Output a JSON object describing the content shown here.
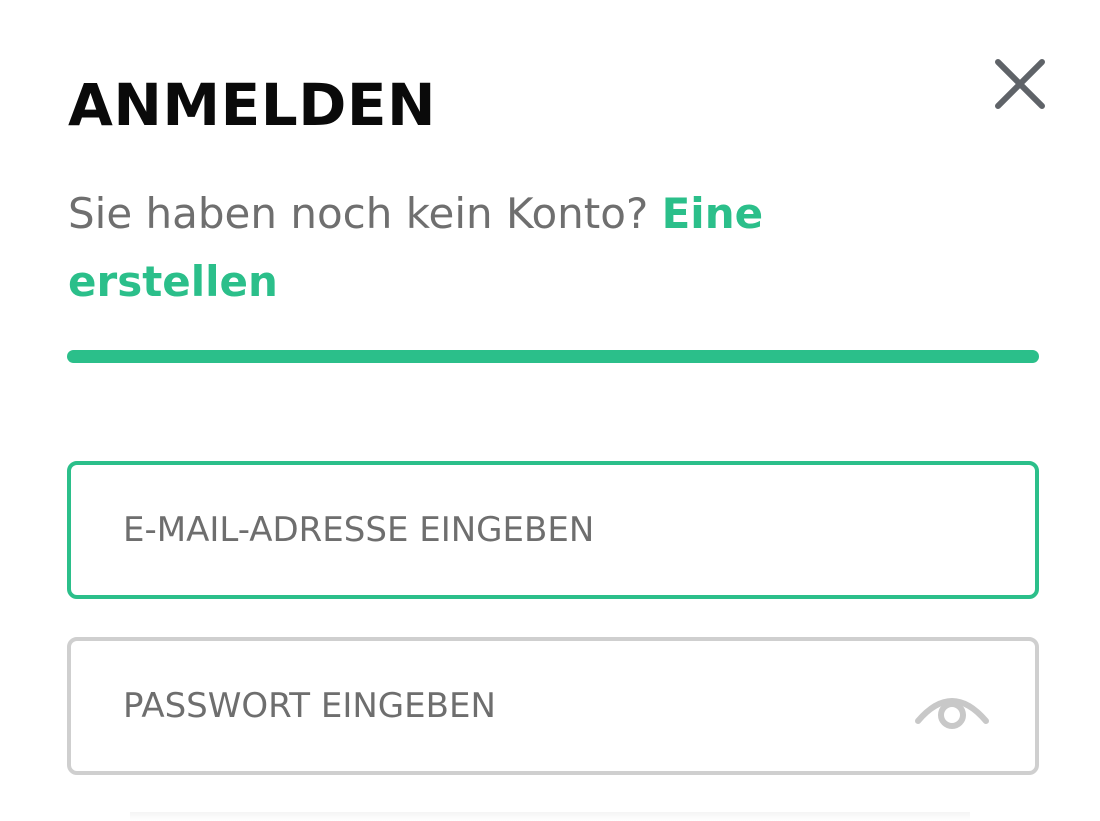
{
  "dialog": {
    "title": "ANMELDEN",
    "close_icon": "close-icon",
    "prompt_text": "Sie haben noch kein Konto?",
    "create_link": "Eine erstellen",
    "accent_color": "#2bbf8a"
  },
  "form": {
    "email": {
      "placeholder": "E-MAIL-ADRESSE EINGEBEN",
      "value": ""
    },
    "password": {
      "placeholder": "PASSWORT EINGEBEN",
      "value": "",
      "toggle_icon": "eye-icon"
    }
  }
}
